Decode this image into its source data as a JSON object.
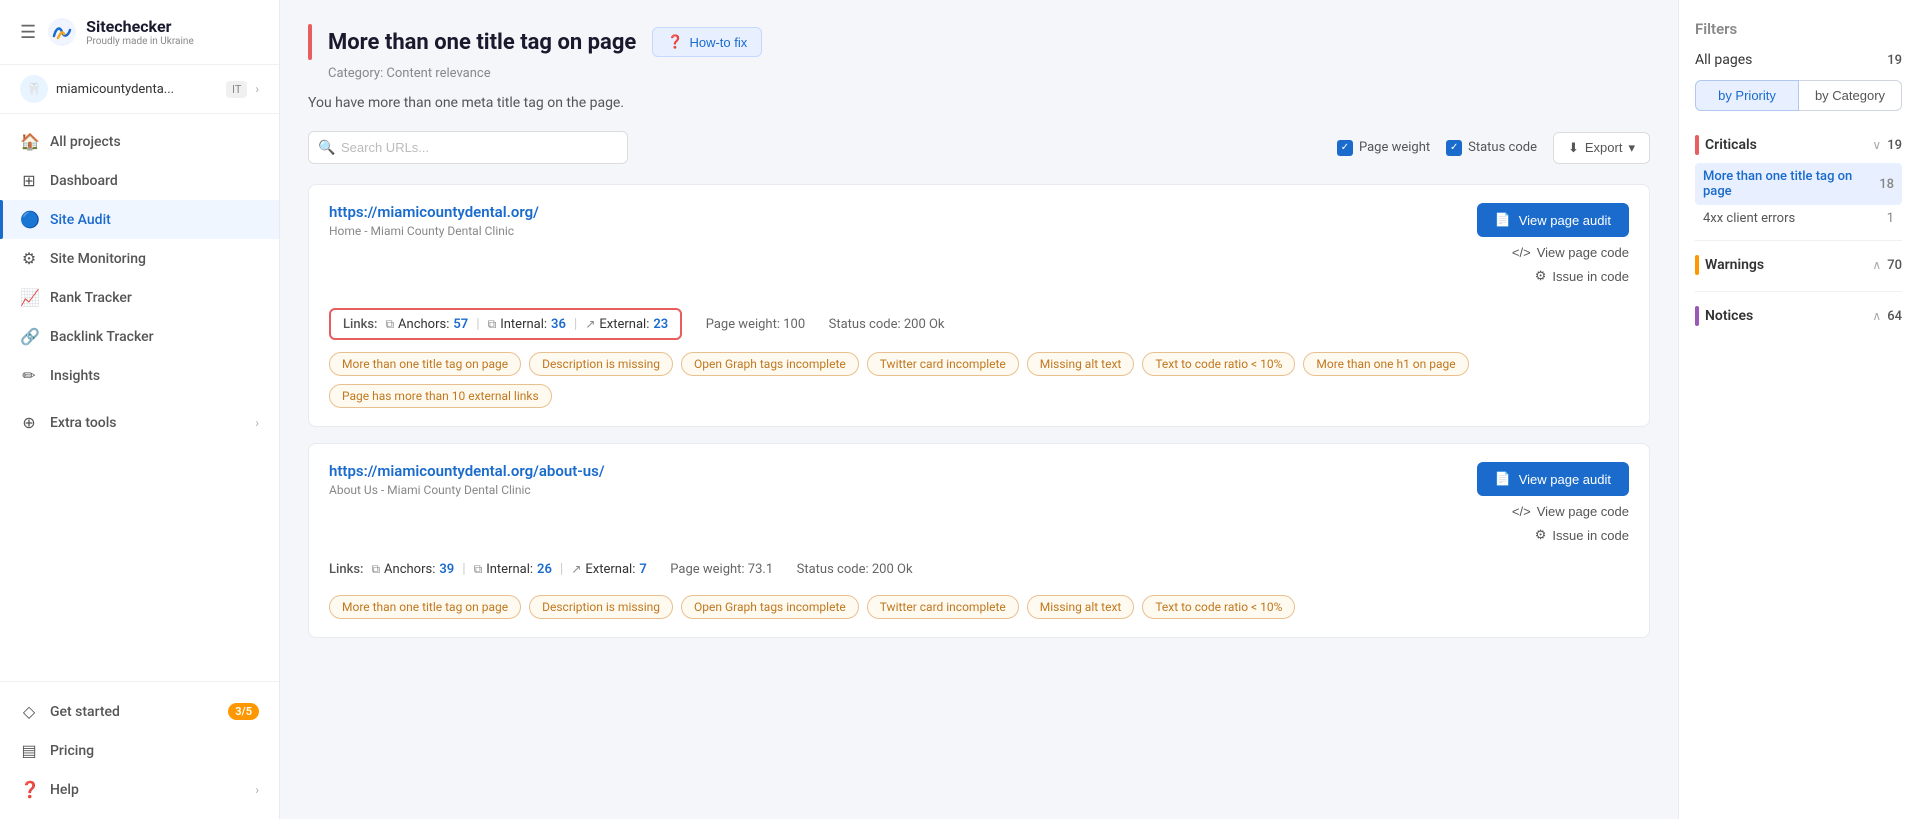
{
  "sidebar": {
    "logo_name": "Sitechecker",
    "logo_tagline": "Proudly made in Ukraine",
    "project_name": "miamicountydenta...",
    "project_badge": "IT",
    "nav_items": [
      {
        "id": "all-projects",
        "label": "All projects",
        "icon": "🏠"
      },
      {
        "id": "dashboard",
        "label": "Dashboard",
        "icon": "⊞"
      },
      {
        "id": "site-audit",
        "label": "Site Audit",
        "icon": "🔵",
        "active": true
      },
      {
        "id": "site-monitoring",
        "label": "Site Monitoring",
        "icon": "⚙"
      },
      {
        "id": "rank-tracker",
        "label": "Rank Tracker",
        "icon": "📈"
      },
      {
        "id": "backlink-tracker",
        "label": "Backlink Tracker",
        "icon": "🔗"
      },
      {
        "id": "insights",
        "label": "Insights",
        "icon": "✏"
      }
    ],
    "extra_tools_label": "Extra tools",
    "get_started_label": "Get started",
    "get_started_badge": "3/5",
    "pricing_label": "Pricing",
    "help_label": "Help"
  },
  "page": {
    "title": "More than one title tag on page",
    "how_to_fix_label": "How-to fix",
    "category": "Category: Content relevance",
    "description": "You have more than one meta title tag on the page.",
    "search_placeholder": "Search URLs..."
  },
  "controls": {
    "page_weight_label": "Page weight",
    "status_code_label": "Status code",
    "export_label": "Export"
  },
  "cards": [
    {
      "url": "https://miamicountydental.org/",
      "subtitle": "Home - Miami County Dental Clinic",
      "links_label": "Links:",
      "anchors_label": "Anchors:",
      "anchors_count": "57",
      "internal_label": "Internal:",
      "internal_count": "36",
      "external_label": "External:",
      "external_count": "23",
      "page_weight": "Page weight: 100",
      "status_code": "Status code: 200 Ok",
      "has_red_border": true,
      "view_audit_label": "View page audit",
      "view_code_label": "View page code",
      "issue_code_label": "Issue in code",
      "tags": [
        "More than one title tag on page",
        "Description is missing",
        "Open Graph tags incomplete",
        "Twitter card incomplete",
        "Missing alt text",
        "Text to code ratio < 10%",
        "More than one h1 on page",
        "Page has more than 10 external links"
      ]
    },
    {
      "url": "https://miamicountydental.org/about-us/",
      "subtitle": "About Us - Miami County Dental Clinic",
      "links_label": "Links:",
      "anchors_label": "Anchors:",
      "anchors_count": "39",
      "internal_label": "Internal:",
      "internal_count": "26",
      "external_label": "External:",
      "external_count": "7",
      "page_weight": "Page weight: 73.1",
      "status_code": "Status code: 200 Ok",
      "has_red_border": false,
      "view_audit_label": "View page audit",
      "view_code_label": "View page code",
      "issue_code_label": "Issue in code",
      "tags": [
        "More than one title tag on page",
        "Description is missing",
        "Open Graph tags incomplete",
        "Twitter card incomplete",
        "Missing alt text",
        "Text to code ratio < 10%"
      ]
    }
  ],
  "right_panel": {
    "filters_title": "Filters",
    "all_pages_label": "All pages",
    "all_pages_count": "19",
    "by_priority_label": "by Priority",
    "by_category_label": "by Category",
    "sections": [
      {
        "label": "Criticals",
        "type": "criticals",
        "count": "19",
        "expanded": true,
        "items": [
          {
            "label": "More than one title tag on page",
            "count": "18",
            "active": true
          },
          {
            "label": "4xx client errors",
            "count": "1",
            "active": false
          }
        ]
      },
      {
        "label": "Warnings",
        "type": "warnings",
        "count": "70",
        "expanded": false,
        "items": []
      },
      {
        "label": "Notices",
        "type": "notices",
        "count": "64",
        "expanded": false,
        "items": []
      }
    ]
  }
}
